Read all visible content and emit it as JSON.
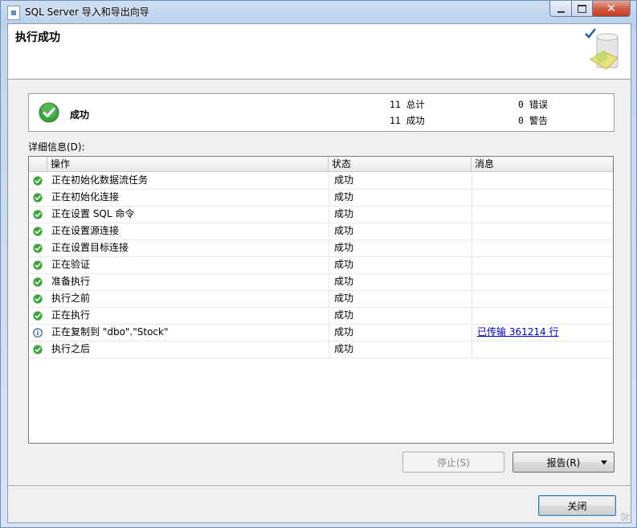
{
  "window": {
    "title": "SQL Server 导入和导出向导",
    "close_glyph": "✕"
  },
  "header": {
    "title": "执行成功"
  },
  "summary": {
    "status": "成功",
    "total_count": "11",
    "total_label": "总计",
    "success_count": "11",
    "success_label": "成功",
    "error_count": "0",
    "error_label": "错误",
    "warning_count": "0",
    "warning_label": "警告"
  },
  "details": {
    "label": "详细信息(D):",
    "columns": [
      "操作",
      "状态",
      "消息"
    ],
    "rows": [
      {
        "icon": "success-icon",
        "action": "正在初始化数据流任务",
        "status": "成功",
        "message": ""
      },
      {
        "icon": "success-icon",
        "action": "正在初始化连接",
        "status": "成功",
        "message": ""
      },
      {
        "icon": "success-icon",
        "action": "正在设置 SQL 命令",
        "status": "成功",
        "message": ""
      },
      {
        "icon": "success-icon",
        "action": "正在设置源连接",
        "status": "成功",
        "message": ""
      },
      {
        "icon": "success-icon",
        "action": "正在设置目标连接",
        "status": "成功",
        "message": ""
      },
      {
        "icon": "success-icon",
        "action": "正在验证",
        "status": "成功",
        "message": ""
      },
      {
        "icon": "success-icon",
        "action": "准备执行",
        "status": "成功",
        "message": ""
      },
      {
        "icon": "success-icon",
        "action": "执行之前",
        "status": "成功",
        "message": ""
      },
      {
        "icon": "success-icon",
        "action": "正在执行",
        "status": "成功",
        "message": ""
      },
      {
        "icon": "info-icon",
        "action": "正在复制到 \"dbo\".\"Stock\"",
        "status": "成功",
        "message": "已传输 361214 行"
      },
      {
        "icon": "success-icon",
        "action": "执行之后",
        "status": "成功",
        "message": ""
      }
    ]
  },
  "buttons": {
    "stop": "停止(S)",
    "report": "报告(R)",
    "close": "关闭"
  },
  "colors": {
    "success_green": "#3aa63a",
    "info_blue": "#2b5fb4",
    "link_blue": "#0000cc"
  }
}
